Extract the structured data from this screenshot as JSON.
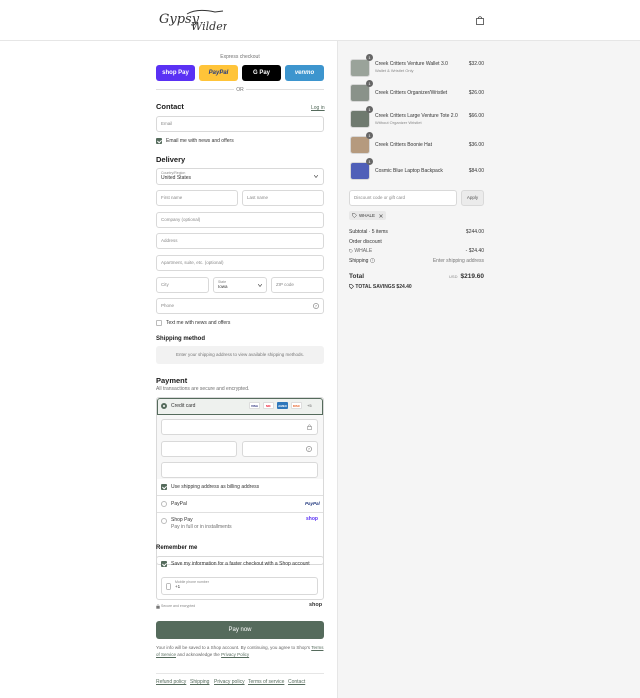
{
  "header": {
    "logo_text": "Gypsy Wilder",
    "cart_icon": "bag-icon"
  },
  "express": {
    "title": "Express checkout",
    "buttons": [
      {
        "label": "shop Pay",
        "color": "#5a31f4"
      },
      {
        "label": "PayPal",
        "color": "#ffc439"
      },
      {
        "label": "G Pay",
        "color": "#000000"
      },
      {
        "label": "venmo",
        "color": "#3d95ce"
      }
    ],
    "or": "OR"
  },
  "contact": {
    "title": "Contact",
    "login": "Log in",
    "email_placeholder": "Email",
    "news_label": "Email me with news and offers"
  },
  "delivery": {
    "title": "Delivery",
    "country_label": "Country/Region",
    "country_value": "United States",
    "first_name": "First name",
    "last_name": "Last name",
    "company": "Company (optional)",
    "address": "Address",
    "apartment": "Apartment, suite, etc. (optional)",
    "city": "City",
    "state_label": "State",
    "state_value": "Iowa",
    "zip": "ZIP code",
    "phone": "Phone",
    "text_news": "Text me with news and offers"
  },
  "shipping": {
    "title": "Shipping method",
    "note": "Enter your shipping address to view available shipping methods."
  },
  "payment": {
    "title": "Payment",
    "subtitle": "All transactions are secure and encrypted.",
    "credit_card": "Credit card",
    "card_badges": [
      "VISA",
      "MC",
      "AMEX",
      "DISC"
    ],
    "more_cards": "+5",
    "billing_same": "Use shipping address as billing address",
    "paypal": "PayPal",
    "paypal_logo": "PayPal",
    "shoppay": "Shop Pay",
    "shoppay_sub": "Pay in full or in installments",
    "shoppay_logo": "shop"
  },
  "remember": {
    "title": "Remember me",
    "save_label": "Save my information for a faster checkout with a Shop account",
    "mobile_label": "Mobile phone number",
    "mobile_value": "+1",
    "secure": "Secure and encrypted",
    "shop_logo": "shop"
  },
  "pay_button": "Pay now",
  "legal": {
    "text1": "Your info will be saved to a Shop account. By continuing, you agree to Shop's",
    "tos": "Terms of Service",
    "and": "and acknowledge the",
    "privacy": "Privacy Policy"
  },
  "footer": [
    "Refund policy",
    "Shipping",
    "Privacy policy",
    "Terms of service",
    "Contact"
  ],
  "cart": {
    "items": [
      {
        "qty": "1",
        "name": "Creek Critters Venture Wallet 3.0",
        "variant": "Wallet & Wristlet Only",
        "price": "$32.00"
      },
      {
        "qty": "1",
        "name": "Creek Critters Organizer/Wristlet",
        "variant": "",
        "price": "$26.00"
      },
      {
        "qty": "1",
        "name": "Creek Critters Large Venture Tote 2.0",
        "variant": "Without Organizer Wristlet",
        "price": "$66.00"
      },
      {
        "qty": "1",
        "name": "Creek Critters Boonie Hat",
        "variant": "",
        "price": "$36.00"
      },
      {
        "qty": "1",
        "name": "Cosmic Blue Laptop Backpack",
        "variant": "",
        "price": "$84.00"
      }
    ],
    "discount_placeholder": "Discount code or gift card",
    "apply": "Apply",
    "code_tag": "WHALE",
    "subtotal_label": "Subtotal · 5 items",
    "subtotal": "$244.00",
    "order_discount": "Order discount",
    "discount_code": "WHALE",
    "discount_amount": "- $24.40",
    "shipping_label": "Shipping",
    "shipping_value": "Enter shipping address",
    "total_label": "Total",
    "currency": "USD",
    "total": "$219.60",
    "savings_label": "TOTAL SAVINGS",
    "savings": "$24.40"
  }
}
